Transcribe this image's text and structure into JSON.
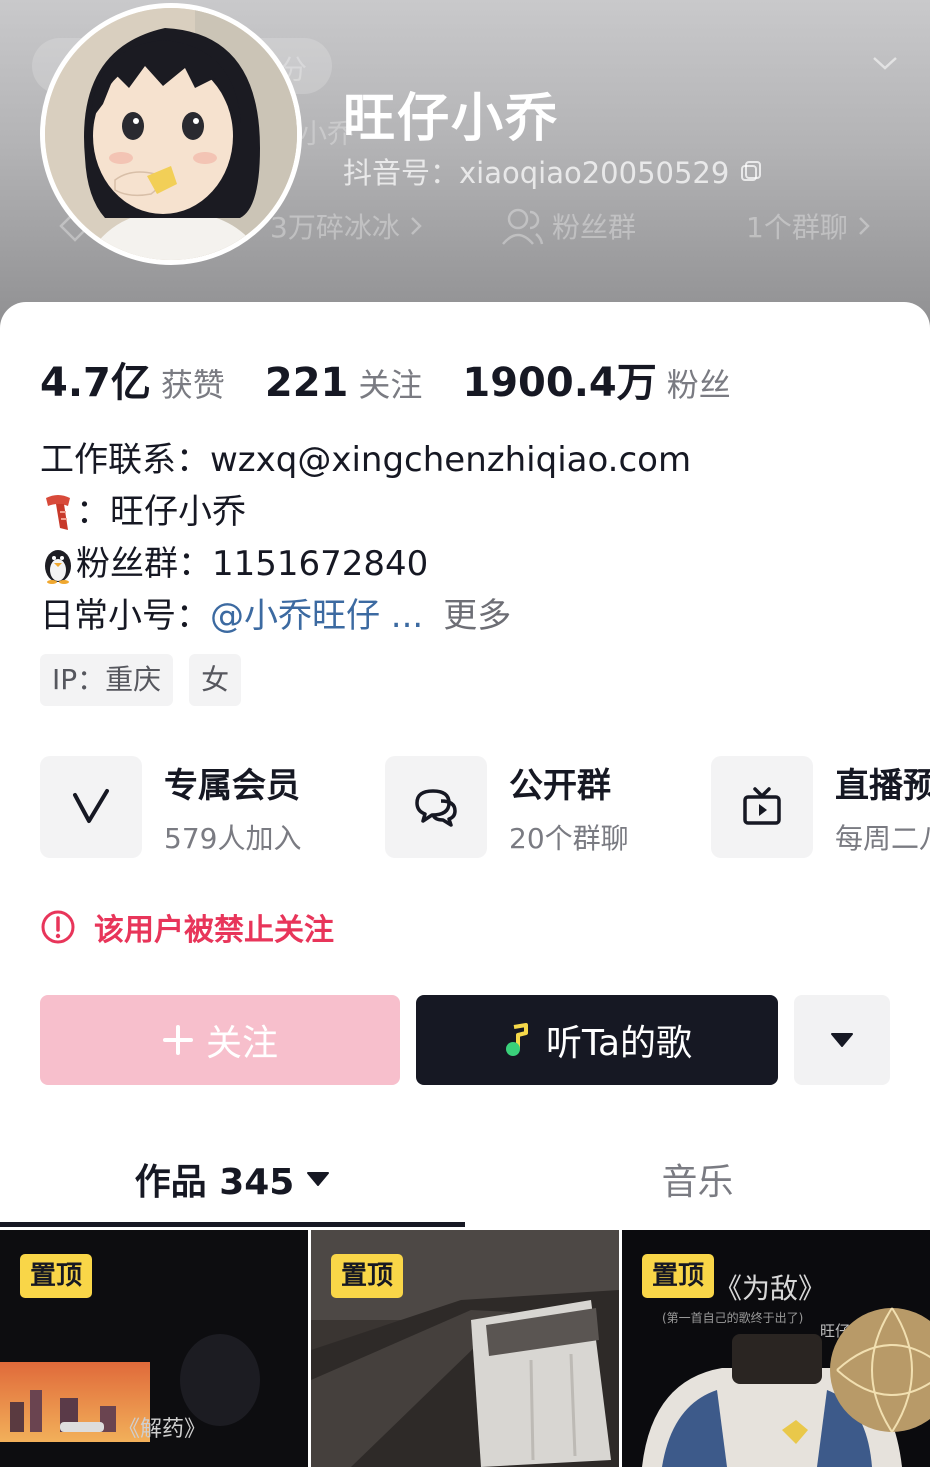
{
  "header": {
    "nickname": "旺仔小乔",
    "douyin_id": "抖音号：xiaoqiao20050529",
    "faded_pill_text": "分",
    "faded_name_text": "小乔",
    "row": [
      {
        "label": "3万碎冰冰",
        "icon": "diamond-icon"
      },
      {
        "label": "粉丝群",
        "icon": "group-icon"
      },
      {
        "label": "1个群聊",
        "icon": "chevron-right-icon"
      }
    ]
  },
  "stats": [
    {
      "num": "4.7亿",
      "label": "获赞"
    },
    {
      "num": "221",
      "label": "关注"
    },
    {
      "num": "1900.4万",
      "label": "粉丝"
    }
  ],
  "bio": {
    "work_label": "工作联系：",
    "work_email": "wzxq@xingchenzhiqiao.com",
    "scarf_text": "：旺仔小乔",
    "fans_group": "粉丝群：1151672840",
    "daily_label": "日常小号：",
    "daily_link": "@小乔旺仔 ...",
    "more": "更多"
  },
  "tags": [
    "IP：重庆",
    "女"
  ],
  "services": [
    {
      "title": "专属会员",
      "sub": "579人加入",
      "icon": "v-icon"
    },
    {
      "title": "公开群",
      "sub": "20个群聊",
      "icon": "chat-bubble-icon"
    },
    {
      "title": "直播预",
      "sub": "每周二八",
      "icon": "tv-icon"
    }
  ],
  "warning": "该用户被禁止关注",
  "actions": {
    "follow": "关注",
    "listen": "听Ta的歌"
  },
  "tabs": {
    "works": "作品 345",
    "music": "音乐"
  },
  "thumbs": [
    {
      "badge": "置顶",
      "caption": "《解药》"
    },
    {
      "badge": "置顶",
      "caption": ""
    },
    {
      "badge": "置顶",
      "caption": "《为敌》",
      "sub": "(第一首自己的歌终于出了)",
      "artist": "旺仔小乔"
    }
  ],
  "colors": {
    "accent_red": "#e8355a",
    "follow_pink": "#f7bfcc",
    "dark": "#161823",
    "link_blue": "#3c6aa1",
    "pin_yellow": "#f9d648"
  }
}
